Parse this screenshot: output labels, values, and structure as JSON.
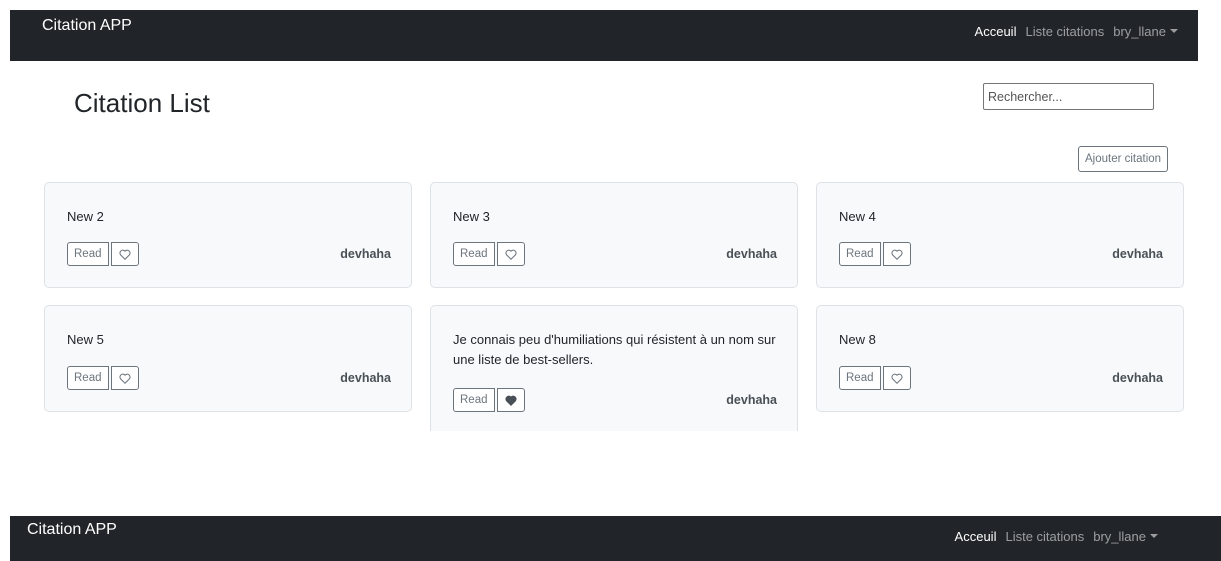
{
  "navbar": {
    "brand": "Citation APP",
    "links": [
      "Acceuil",
      "Liste citations"
    ],
    "user": "bry_llane"
  },
  "page": {
    "title": "Citation List",
    "search_placeholder": "Rechercher...",
    "add_label": "Ajouter citation"
  },
  "cards": [
    {
      "text": "New 2",
      "read": "Read",
      "author": "devhaha",
      "liked": false
    },
    {
      "text": "New 3",
      "read": "Read",
      "author": "devhaha",
      "liked": false
    },
    {
      "text": "New 4",
      "read": "Read",
      "author": "devhaha",
      "liked": false
    },
    {
      "text": "New 5",
      "read": "Read",
      "author": "devhaha",
      "liked": false
    },
    {
      "text": "Je connais peu d'humiliations qui résistent à un nom sur une liste de best-sellers.",
      "read": "Read",
      "author": "devhaha",
      "liked": true
    },
    {
      "text": "New 8",
      "read": "Read",
      "author": "devhaha",
      "liked": false
    }
  ],
  "footer_navbar": {
    "brand": "Citation APP",
    "links": [
      "Acceuil",
      "Liste citations"
    ],
    "user": "bry_llane"
  }
}
